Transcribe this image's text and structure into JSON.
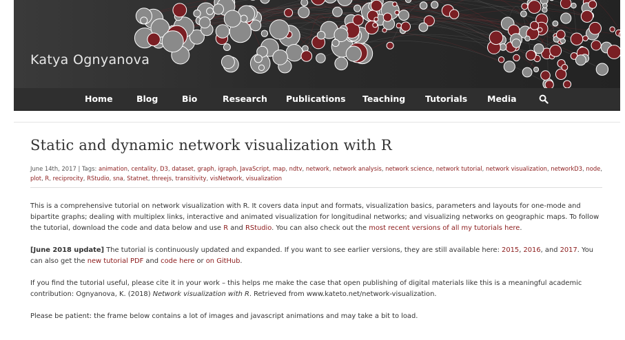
{
  "site": {
    "title": "Katya Ognyanova"
  },
  "colors": {
    "accent": "#8b1a1a",
    "nav_bg": "#2f2f2f",
    "header_bg": "#2c2c2c",
    "node_grey": "#8a8a8a",
    "node_red": "#7a1f24"
  },
  "nav": {
    "items": [
      {
        "label": "Home"
      },
      {
        "label": "Blog"
      },
      {
        "label": "Bio"
      },
      {
        "label": "Research"
      },
      {
        "label": "Publications"
      },
      {
        "label": "Teaching"
      },
      {
        "label": "Tutorials"
      },
      {
        "label": "Media"
      }
    ],
    "search_icon": "search-icon"
  },
  "post": {
    "title": "Static and dynamic network visualization with R",
    "date": "June 14th, 2017",
    "tags_label": "Tags:",
    "tags": [
      "animation",
      "centality",
      "D3",
      "dataset",
      "graph",
      "igraph",
      "JavaScript",
      "map",
      "ndtv",
      "network",
      "network analysis",
      "network science",
      "network tutorial",
      "network visualization",
      "networkD3",
      "node",
      "plot",
      "R",
      "reciprocity",
      "RStudio",
      "sna",
      "Statnet",
      "threejs",
      "transitivity",
      "visNetwork",
      "visualization"
    ]
  },
  "content": {
    "p1": {
      "t1": "This is a comprehensive tutorial on network visualization with R. It covers data input and formats, visualization basics, parameters and layouts for one-mode and bipartite graphs; dealing with multiplex links, interactive and animated visualization for longitudinal networks; and visualizing networks on geographic maps. To follow the tutorial, download the code and data below and use ",
      "l1": "R",
      "t2": " and ",
      "l2": "RStudio",
      "t3": ". You can also check out the ",
      "l3": "most recent versions of all my tutorials here",
      "t4": "."
    },
    "p2": {
      "bold": "[June 2018 update]",
      "t1": " The tutorial is continuously updated and expanded. If you want to see earlier versions, they are still available here: ",
      "l1": "2015",
      "t2": ", ",
      "l2": "2016",
      "t3": ", and ",
      "l3": "2017",
      "t4": ". You can also get the ",
      "l4": "new tutorial PDF",
      "t5": " and ",
      "l5": "code here",
      "t6": " or ",
      "l6": "on GitHub",
      "t7": "."
    },
    "p3": {
      "t1": "If you find the tutorial useful, please cite it in your work – this helps me make the case that open publishing of digital materials like this is a meaningful academic contribution: Ognyanova, K. (2018) ",
      "em": "Network visualization with R",
      "t2": ". Retrieved from www.kateto.net/network-visualization."
    },
    "p4": {
      "t1": "Please be patient: the frame below contains a lot of images and javascript animations and may take a bit to load."
    }
  }
}
